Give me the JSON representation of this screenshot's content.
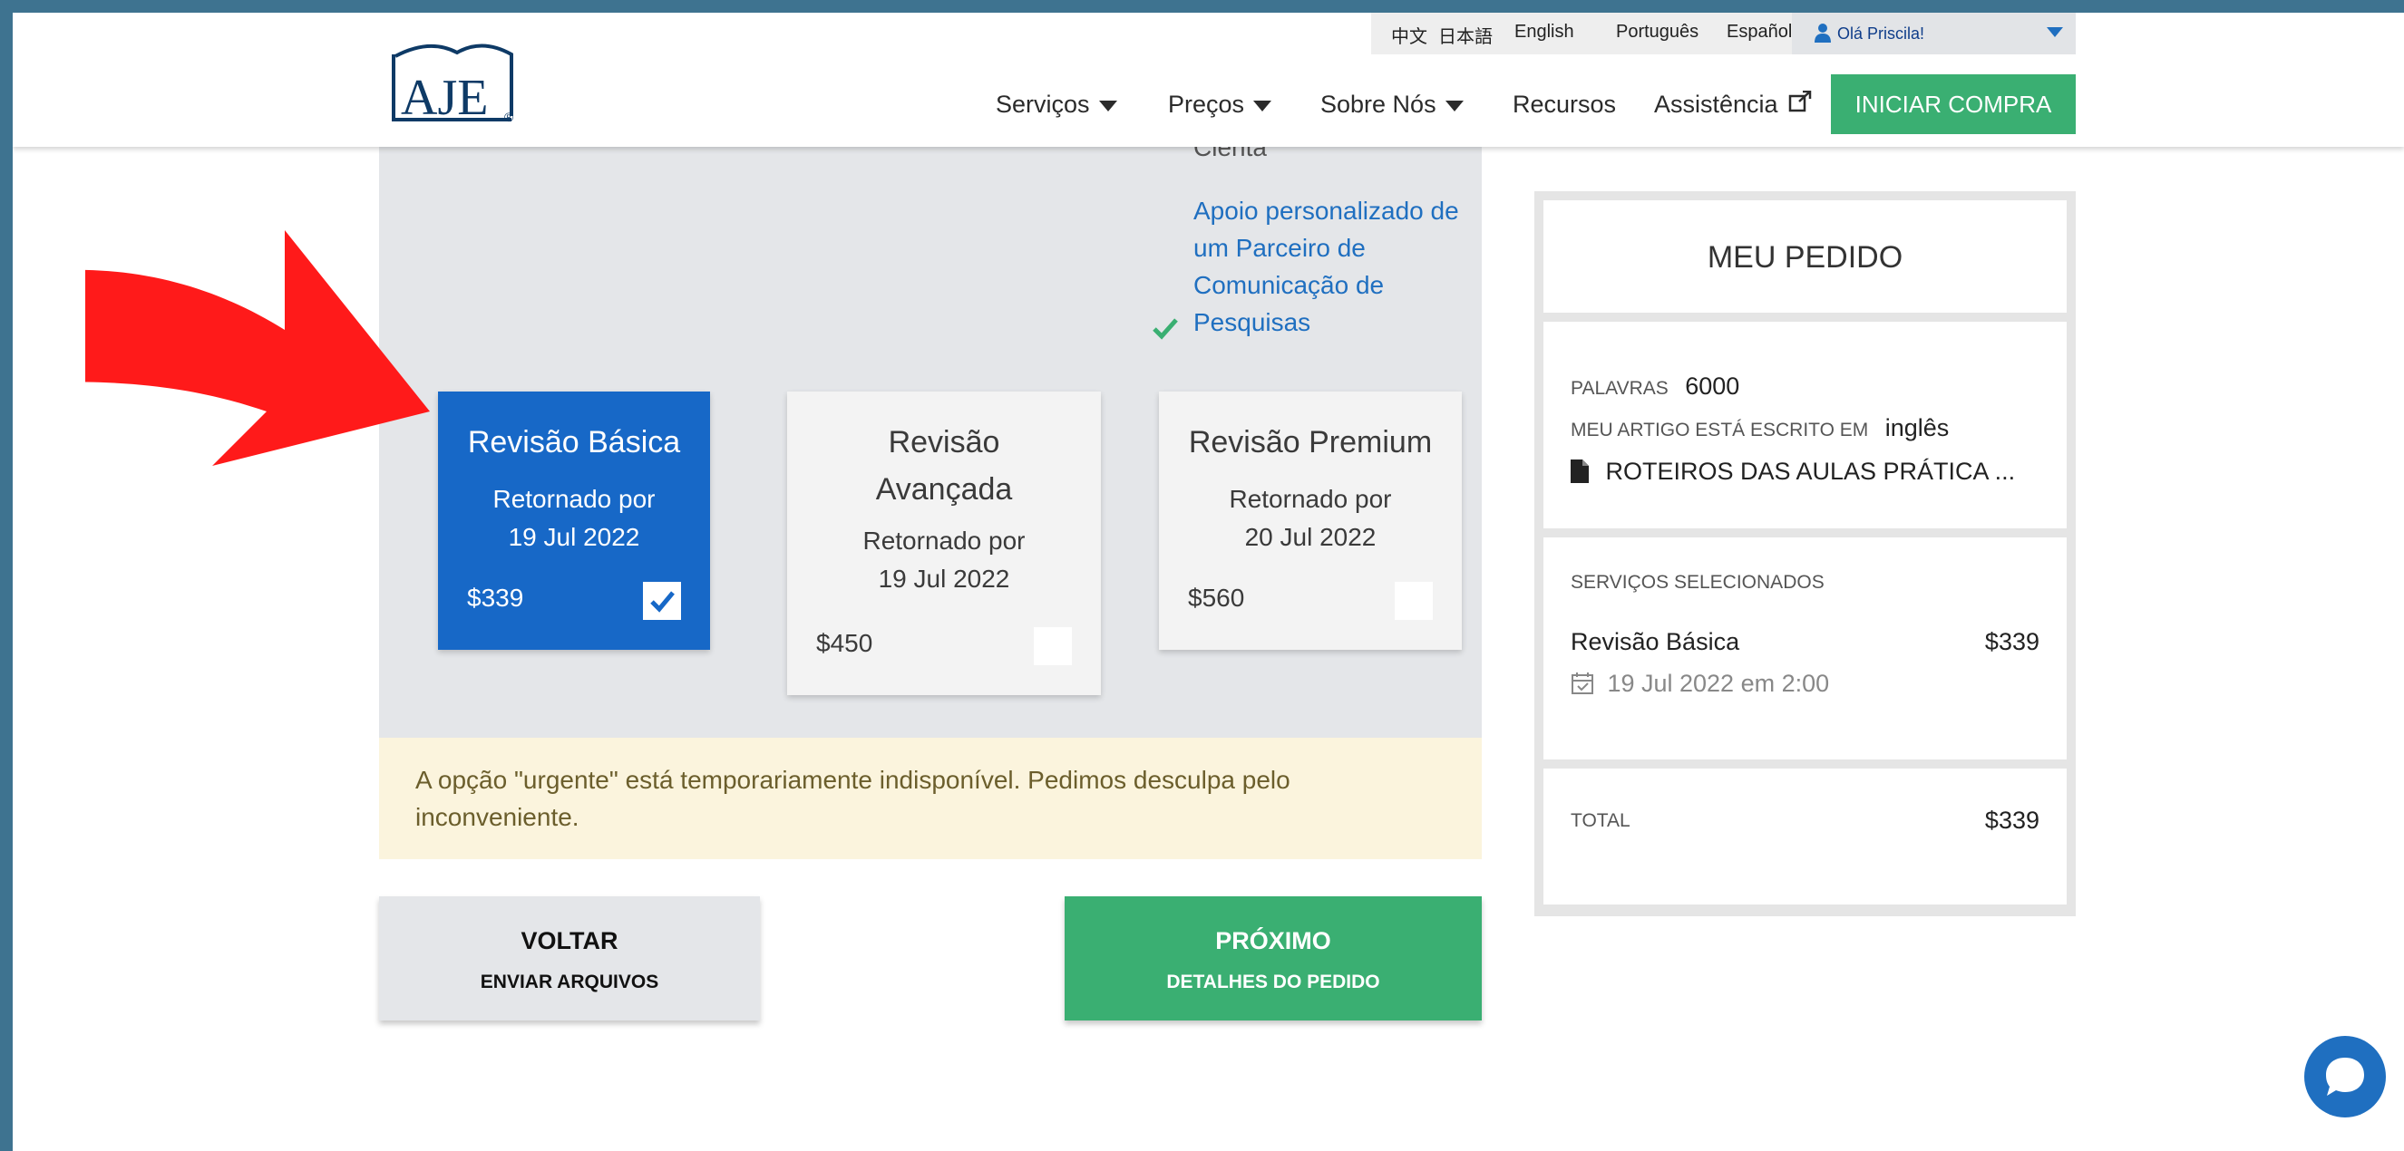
{
  "header": {
    "logo_text": "AJE",
    "languages": [
      "中文",
      "日本語",
      "English",
      "Português",
      "Español"
    ],
    "user_greeting": "Olá Priscila!",
    "nav": [
      {
        "label": "Serviços",
        "dropdown": true
      },
      {
        "label": "Preços",
        "dropdown": true
      },
      {
        "label": "Sobre Nós",
        "dropdown": true
      },
      {
        "label": "Recursos",
        "dropdown": false
      },
      {
        "label": "Assistência",
        "dropdown": false,
        "external": true
      }
    ],
    "cta_label": "INICIAR COMPRA"
  },
  "plans_panel": {
    "feature_cut_text": "Cienta",
    "feature_text": "Apoio personalizado de um Parceiro de Comunicação de Pesquisas",
    "plans": [
      {
        "name": "Revisão Básica",
        "returned_label": "Retornado por",
        "date": "19 Jul 2022",
        "price": "$339",
        "selected": true
      },
      {
        "name": "Revisão Avançada",
        "returned_label": "Retornado por",
        "date": "19 Jul 2022",
        "price": "$450",
        "selected": false
      },
      {
        "name": "Revisão Premium",
        "returned_label": "Retornado por",
        "date": "20 Jul 2022",
        "price": "$560",
        "selected": false
      }
    ]
  },
  "urgent_notice": "A opção \"urgente\" está temporariamente indisponível. Pedimos desculpa pelo inconveniente.",
  "actions": {
    "back_label": "VOLTAR",
    "back_sub": "ENVIAR ARQUIVOS",
    "next_label": "PRÓXIMO",
    "next_sub": "DETALHES DO PEDIDO"
  },
  "order": {
    "title": "MEU PEDIDO",
    "words_label": "PALAVRAS",
    "words_value": "6000",
    "language_label": "MEU ARTIGO ESTÁ ESCRITO EM",
    "language_value": "inglês",
    "file_name": "ROTEIROS DAS AULAS PRÁTICA ...",
    "services_label": "SERVIÇOS SELECIONADOS",
    "service_name": "Revisão Básica",
    "service_price": "$339",
    "service_date": "19 Jul 2022 em 2:00",
    "total_label": "TOTAL",
    "total_value": "$339"
  },
  "colors": {
    "frame": "#3e7390",
    "selected_plan": "#1768c7",
    "green": "#3aaf72",
    "arrow": "#ff1a1a",
    "link_blue": "#1f6fc0"
  }
}
